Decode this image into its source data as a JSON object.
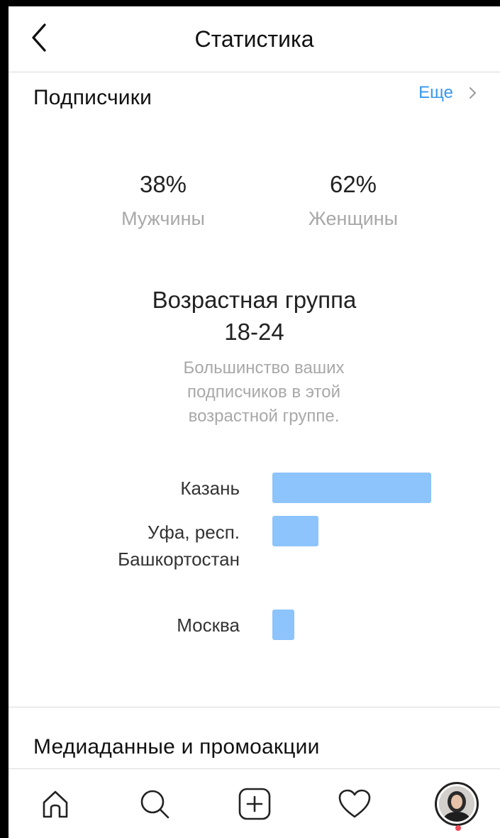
{
  "header": {
    "title": "Статистика",
    "back_icon": "chevron-left-icon"
  },
  "followers": {
    "section_title": "Подписчики",
    "more_label": "Еще",
    "men": {
      "percent": "38%",
      "label": "Мужчины",
      "value": 38
    },
    "women": {
      "percent": "62%",
      "label": "Женщины",
      "value": 62
    },
    "age_group": {
      "title": "Возрастная группа",
      "value": "18-24",
      "description": "Большинство ваших подписчиков в этой возрастной группе."
    },
    "cities": [
      {
        "name": "Казань",
        "share": 1.0
      },
      {
        "name": "Уфа, респ. Башкортостан",
        "share": 0.29
      },
      {
        "name": "Москва",
        "share": 0.14
      }
    ]
  },
  "media": {
    "section_title": "Медиаданные и промоакции"
  },
  "tab_bar": {
    "items": [
      "home-icon",
      "search-icon",
      "add-post-icon",
      "activity-heart-icon",
      "profile-avatar"
    ]
  },
  "colors": {
    "accent": "#3897f0",
    "bar": "#8cc4fb",
    "notification": "#ed4956"
  }
}
